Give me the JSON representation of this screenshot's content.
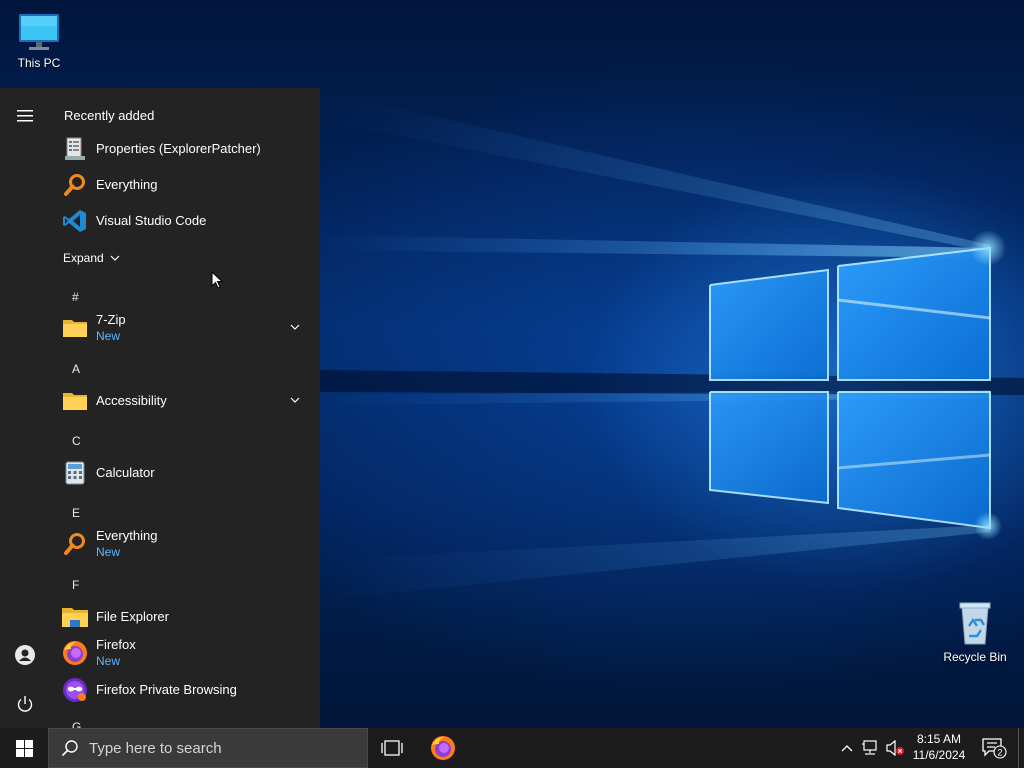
{
  "desktop": {
    "this_pc_label": "This PC",
    "recycle_bin_label": "Recycle Bin"
  },
  "start_menu": {
    "recently_added_heading": "Recently added",
    "recent": [
      {
        "name": "Properties (ExplorerPatcher)",
        "icon": "properties-icon"
      },
      {
        "name": "Everything",
        "icon": "everything-icon"
      },
      {
        "name": "Visual Studio Code",
        "icon": "vscode-icon"
      }
    ],
    "expand_label": "Expand",
    "groups": [
      {
        "letter": "#",
        "items": [
          {
            "name": "7-Zip",
            "badge": "New",
            "icon": "folder-icon",
            "expandable": true
          }
        ]
      },
      {
        "letter": "A",
        "items": [
          {
            "name": "Accessibility",
            "badge": "",
            "icon": "folder-icon",
            "expandable": true
          }
        ]
      },
      {
        "letter": "C",
        "items": [
          {
            "name": "Calculator",
            "badge": "",
            "icon": "calculator-icon",
            "expandable": false
          }
        ]
      },
      {
        "letter": "E",
        "items": [
          {
            "name": "Everything",
            "badge": "New",
            "icon": "everything-icon",
            "expandable": false
          }
        ]
      },
      {
        "letter": "F",
        "items": [
          {
            "name": "File Explorer",
            "badge": "",
            "icon": "file-explorer-icon",
            "expandable": false
          },
          {
            "name": "Firefox",
            "badge": "New",
            "icon": "firefox-icon",
            "expandable": false
          },
          {
            "name": "Firefox Private Browsing",
            "badge": "",
            "icon": "firefox-private-icon",
            "expandable": false
          }
        ]
      },
      {
        "letter": "G",
        "items": []
      }
    ]
  },
  "taskbar": {
    "search_placeholder": "Type here to search",
    "clock_time": "8:15 AM",
    "clock_date": "11/6/2024",
    "notification_count": "2"
  },
  "colors": {
    "start_menu_bg": "#232323",
    "taskbar_bg": "#1c1c1c",
    "accent_new": "#5cb5ff"
  }
}
